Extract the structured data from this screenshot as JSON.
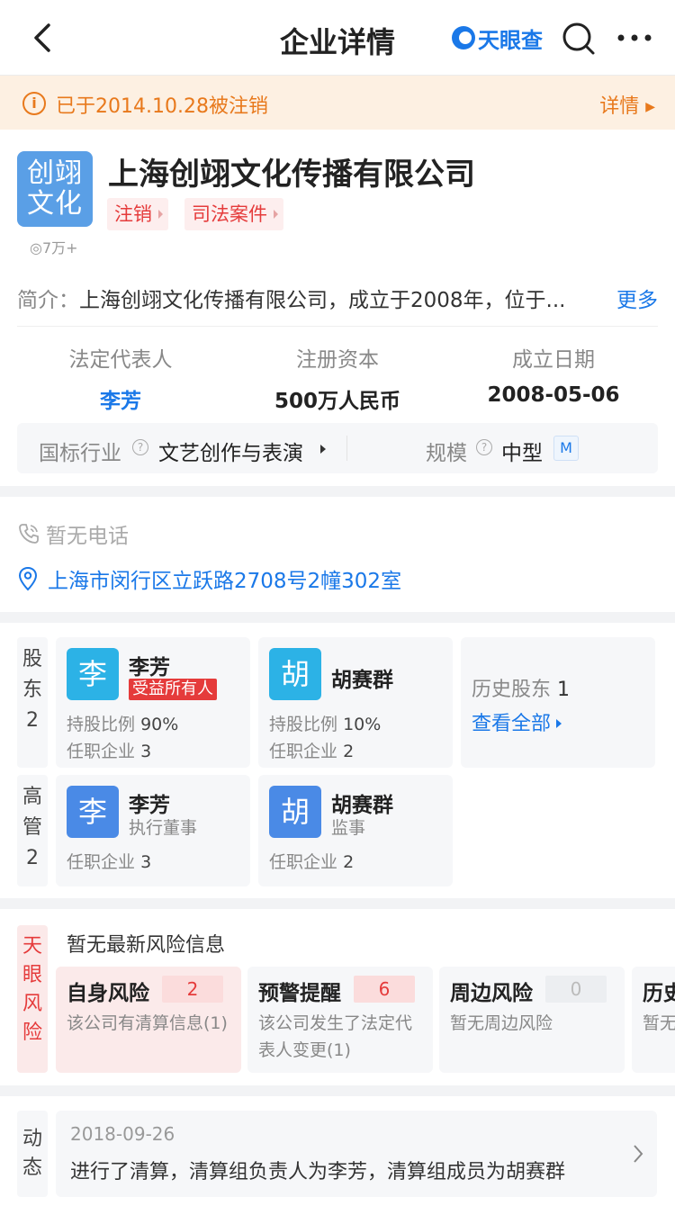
{
  "nav": {
    "title": "企业详情",
    "brand": "天眼查"
  },
  "banner": {
    "text": "已于2014.10.28被注销",
    "detail_label": "详情"
  },
  "company": {
    "logo_text": "创翊文化",
    "name": "上海创翊文化传播有限公司",
    "views": "7万+",
    "tags": [
      "注销",
      "司法案件"
    ],
    "intro_label": "简介：",
    "intro_text": "上海创翊文化传播有限公司，成立于2008年，位于...",
    "intro_more": "更多",
    "kpis": [
      {
        "label": "法定代表人",
        "value": "李芳"
      },
      {
        "label": "注册资本",
        "value": "500万人民币"
      },
      {
        "label": "成立日期",
        "value": "2008-05-06"
      }
    ],
    "industry_label": "国标行业",
    "industry_value": "文艺创作与表演",
    "scale_label": "规模",
    "scale_value": "中型",
    "scale_badge": "M"
  },
  "contact": {
    "phone": "暂无电话",
    "address": "上海市闵行区立跃路2708号2幢302室"
  },
  "shareholders": {
    "label": "股东",
    "count": "2",
    "items": [
      {
        "avatar": "李",
        "name": "李芳",
        "badge": "受益所有人",
        "ratio_label": "持股比例",
        "ratio": "90%",
        "jobs_label": "任职企业",
        "jobs": "3",
        "color": "#2cb2e6"
      },
      {
        "avatar": "胡",
        "name": "胡赛群",
        "ratio_label": "持股比例",
        "ratio": "10%",
        "jobs_label": "任职企业",
        "jobs": "2",
        "color": "#2cb2e6"
      }
    ],
    "history_label": "历史股东",
    "history_count": "1",
    "view_all": "查看全部"
  },
  "executives": {
    "label": "高管",
    "count": "2",
    "items": [
      {
        "avatar": "李",
        "name": "李芳",
        "role": "执行董事",
        "jobs_label": "任职企业",
        "jobs": "3",
        "color": "#4a8ae6"
      },
      {
        "avatar": "胡",
        "name": "胡赛群",
        "role": "监事",
        "jobs_label": "任职企业",
        "jobs": "2",
        "color": "#4a8ae6"
      }
    ]
  },
  "risk": {
    "label": "天眼风险",
    "title": "暂无最新风险信息",
    "cards": [
      {
        "title": "自身风险",
        "count": "2",
        "desc": "该公司有清算信息(1)"
      },
      {
        "title": "预警提醒",
        "count": "6",
        "desc": "该公司发生了法定代表人变更(1)"
      },
      {
        "title": "周边风险",
        "count": "0",
        "desc": "暂无周边风险"
      },
      {
        "title": "历史风险",
        "count": "",
        "desc": "暂无历史风险"
      }
    ]
  },
  "dynamics": {
    "label": "动态",
    "date": "2018-09-26",
    "text": "进行了清算，清算组负责人为李芳，清算组成员为胡赛群"
  },
  "colors": {
    "accent": "#1a78e8",
    "warning": "#e8791c",
    "danger": "#e53b3b"
  }
}
